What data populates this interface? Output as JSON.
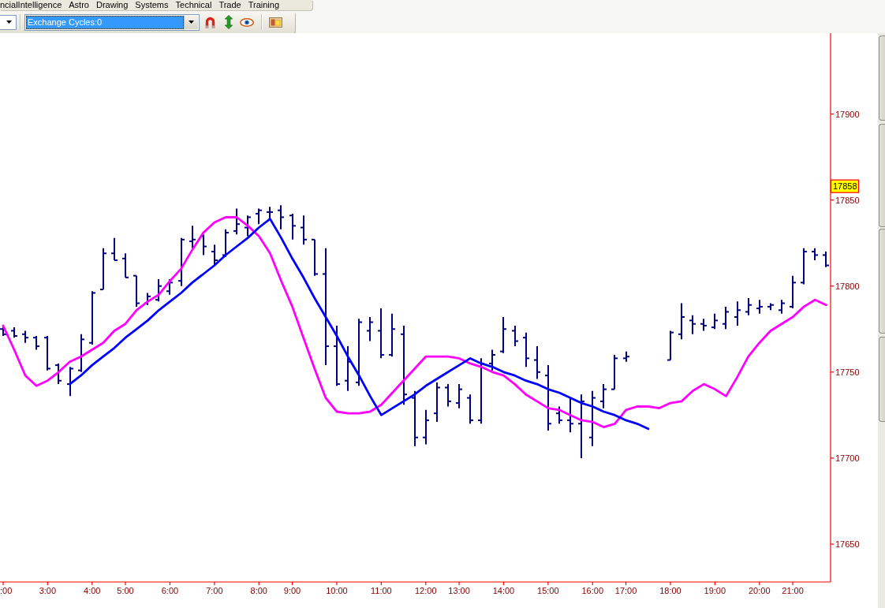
{
  "menu": {
    "items": [
      "ncialIntelligence",
      "Astro",
      "Drawing",
      "Systems",
      "Technical",
      "Trade",
      "Training"
    ]
  },
  "toolbar": {
    "cycle_select": {
      "value": "Exchange Cycles:0",
      "text_selected": true
    }
  },
  "chart": {
    "chart_data": {
      "type": "line",
      "categories": [
        ":00",
        null,
        null,
        null,
        "3:00",
        null,
        null,
        null,
        "4:00",
        null,
        null,
        "5:00",
        null,
        null,
        null,
        "6:00",
        null,
        null,
        null,
        "7:00",
        null,
        null,
        null,
        "8:00",
        null,
        null,
        "9:00",
        null,
        null,
        null,
        "10:00",
        null,
        null,
        null,
        "11:00",
        null,
        null,
        null,
        "12:00",
        null,
        null,
        "13:00",
        null,
        null,
        null,
        "14:00",
        null,
        null,
        null,
        "15:00",
        null,
        null,
        null,
        "16:00",
        null,
        null,
        "17:00",
        null,
        null,
        null,
        "18:00",
        null,
        null,
        null,
        "19:00",
        null,
        null,
        null,
        "20:00",
        null,
        null,
        "21:00",
        null,
        null,
        null
      ],
      "ylim": [
        17628,
        17947
      ],
      "yticks": [
        17650,
        17700,
        17750,
        17800,
        17850,
        17900
      ],
      "annotations": [
        {
          "y": 17858,
          "text": "17858"
        }
      ],
      "series": [
        {
          "color": "#ff00ff",
          "values": [
            17777,
            17763,
            17748,
            17742,
            17745,
            17750,
            17756,
            17759,
            17763,
            17767,
            17774,
            17778,
            17786,
            17791,
            17795,
            17803,
            17810,
            17821,
            17831,
            17837,
            17840,
            17840,
            17835,
            17829,
            17819,
            17803,
            17788,
            17770,
            17752,
            17735,
            17727,
            17726,
            17726,
            17727,
            17731,
            17738,
            17745,
            17752,
            17759,
            17759,
            17759,
            17758,
            17755,
            17753,
            17750,
            17748,
            17743,
            17737,
            17733,
            17729,
            17728,
            17725,
            17722,
            17721,
            17718,
            17720,
            17728,
            17730,
            17730,
            17729,
            17732,
            17733,
            17739,
            17743,
            17740,
            17736,
            17747,
            17759,
            17767,
            17774,
            17778,
            17782,
            17788,
            17792,
            17789
          ]
        },
        {
          "color": "#0000ff",
          "values": [
            null,
            null,
            null,
            null,
            null,
            null,
            17743,
            17748,
            17754,
            17759,
            17764,
            17770,
            17775,
            17780,
            17786,
            17791,
            17796,
            17802,
            17807,
            17812,
            17818,
            17823,
            17828,
            17834,
            17839,
            17828,
            17816,
            17805,
            17793,
            17782,
            17771,
            17759,
            17748,
            17736,
            17725,
            17729,
            17733,
            17737,
            17742,
            17746,
            17750,
            17754,
            17758,
            17755,
            17753,
            17750,
            17748,
            17745,
            17743,
            17740,
            17738,
            17735,
            17732,
            17730,
            17727,
            17725,
            17722,
            17720,
            17717,
            null,
            null,
            null,
            null,
            null,
            null,
            null,
            null,
            null,
            null,
            null,
            null,
            null,
            null,
            null,
            null
          ]
        }
      ]
    }
  }
}
